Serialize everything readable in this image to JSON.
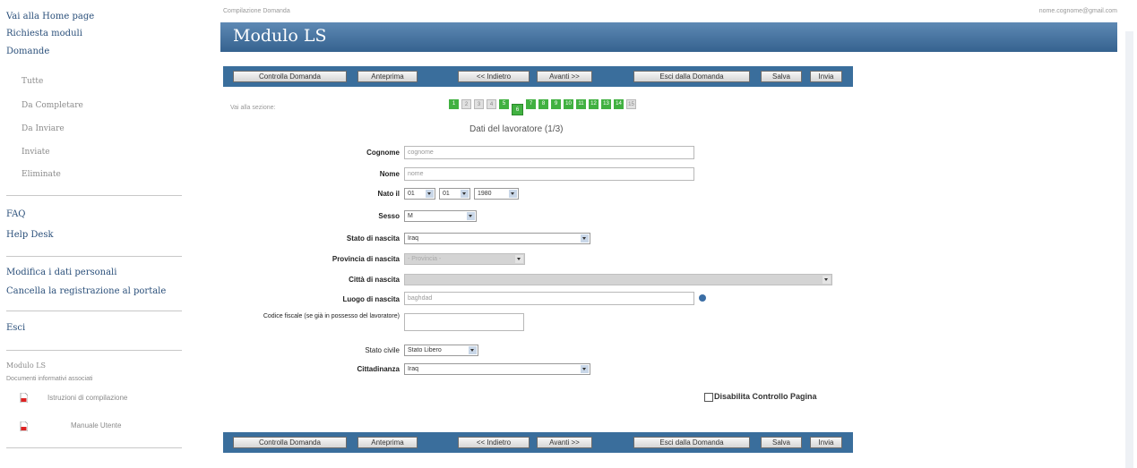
{
  "sidebar": {
    "home": "Vai alla Home page",
    "richiesta": "Richiesta moduli",
    "domande": "Domande",
    "sub": [
      "Tutte",
      "Da Completare",
      "Da Inviare",
      "Inviate",
      "Eliminate"
    ],
    "faq": "FAQ",
    "help": "Help Desk",
    "modifica": "Modifica i dati personali",
    "cancella": "Cancella la registrazione al portale",
    "esci": "Esci",
    "module_name": "Modulo LS",
    "docs_title": "Documenti informativi associati",
    "docs": [
      "Istruzioni di compilazione",
      "Manuale Utente"
    ]
  },
  "header": {
    "breadcrumb": "Compilazione Domanda",
    "user_email": "nome.cognome@gmail.com",
    "title": "Modulo LS"
  },
  "toolbar": {
    "controlla": "Controlla Domanda",
    "anteprima": "Anteprima",
    "indietro": "<< Indietro",
    "avanti": "Avanti >>",
    "esci": "Esci dalla Domanda",
    "salva": "Salva",
    "invia": "Invia"
  },
  "nav": {
    "label": "Vai alla sezione:",
    "sections": [
      {
        "n": "1",
        "state": "done"
      },
      {
        "n": "2",
        "state": "pending"
      },
      {
        "n": "3",
        "state": "pending"
      },
      {
        "n": "4",
        "state": "pending"
      },
      {
        "n": "5",
        "state": "done"
      },
      {
        "n": "6",
        "state": "current"
      },
      {
        "n": "7",
        "state": "done"
      },
      {
        "n": "8",
        "state": "done"
      },
      {
        "n": "9",
        "state": "done"
      },
      {
        "n": "10",
        "state": "done"
      },
      {
        "n": "11",
        "state": "done"
      },
      {
        "n": "12",
        "state": "done"
      },
      {
        "n": "13",
        "state": "done"
      },
      {
        "n": "14",
        "state": "done"
      },
      {
        "n": "15",
        "state": "pending"
      }
    ]
  },
  "form": {
    "title": "Dati del lavoratore (1/3)",
    "labels": {
      "cognome": "Cognome",
      "nome": "Nome",
      "nato": "Nato il",
      "sesso": "Sesso",
      "stato_nascita": "Stato di nascita",
      "provincia": "Provincia di nascita",
      "citta": "Città di nascita",
      "luogo": "Luogo di nascita",
      "codice_fiscale": "Codice fiscale (se già in possesso del lavoratore)",
      "stato_civile": "Stato civile",
      "cittadinanza": "Cittadinanza"
    },
    "values": {
      "cognome": "cognome",
      "nome": "nome",
      "nato_day": "01",
      "nato_month": "01",
      "nato_year": "1980",
      "sesso": "M",
      "stato_nascita": "Iraq",
      "provincia": "- Provincia -",
      "citta": "",
      "luogo": "baghdad",
      "codice_fiscale": "",
      "stato_civile": "Stato Libero",
      "cittadinanza": "Iraq"
    },
    "disable_check_label": "Disabilita Controllo Pagina"
  },
  "colors": {
    "title_bar": "#35628f",
    "toolbar": "#3a6e9c",
    "section_done": "#41b141"
  }
}
